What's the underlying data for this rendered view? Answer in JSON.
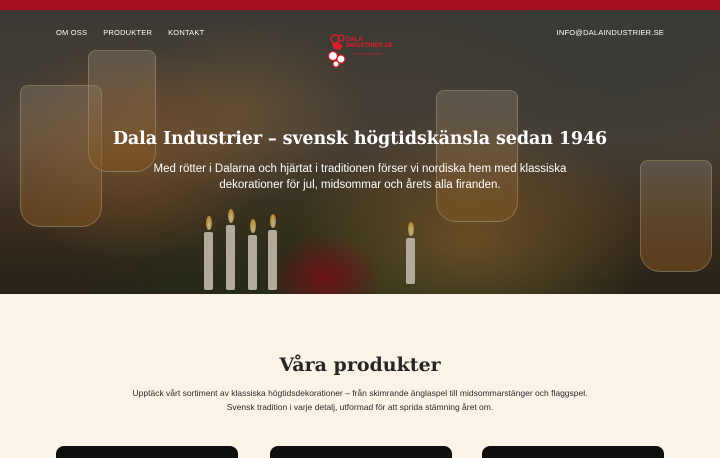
{
  "header": {
    "nav": [
      {
        "label": "OM OSS"
      },
      {
        "label": "PRODUKTER"
      },
      {
        "label": "KONTAKT"
      }
    ],
    "contact_email": "INFO@DALAINDUSTRIER.SE",
    "logo": {
      "name": "DALA INDUSTRIER AB",
      "tagline": "Sverige. Sedan 1946",
      "icon": "dala-horse-logo-icon",
      "color": "#d8202c"
    }
  },
  "hero": {
    "title": "Dala Industrier – svensk högtidskänsla sedan 1946",
    "subtitle": "Med rötter i Dalarna och hjärtat i traditionen förser vi nordiska hem med klassiska dekorationer för jul, midsommar och årets alla firanden."
  },
  "products": {
    "title": "Våra produkter",
    "description": "Upptäck vårt sortiment av klassiska högtidsdekorationer – från skimrande änglaspel till midsommarstänger och flaggspel. Svensk tradition i varje detalj, utformad för att sprida stämning året om."
  },
  "colors": {
    "top_bar": "#a4101f",
    "page_background": "#fbf3e8",
    "card": "#0f0f0f"
  }
}
